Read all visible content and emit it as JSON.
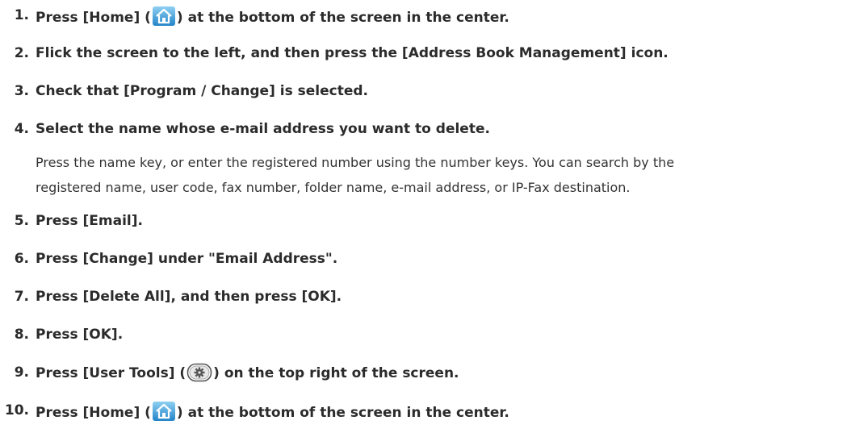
{
  "steps": [
    {
      "number": "1.",
      "before": "Press [Home] (",
      "icon": "home-icon",
      "after": ") at the bottom of the screen in the center."
    },
    {
      "number": "2.",
      "text": "Flick the screen to the left, and then press the [Address Book Management] icon."
    },
    {
      "number": "3.",
      "text": "Check that [Program / Change] is selected."
    },
    {
      "number": "4.",
      "text": "Select the name whose e-mail address you want to delete.",
      "note_lines": [
        "Press the name key, or enter the registered number using the number keys. You can search by the",
        "registered name, user code, fax number, folder name, e-mail address, or IP-Fax destination."
      ]
    },
    {
      "number": "5.",
      "text": "Press [Email]."
    },
    {
      "number": "6.",
      "text": "Press [Change] under \"Email Address\"."
    },
    {
      "number": "7.",
      "text": "Press [Delete All], and then press [OK]."
    },
    {
      "number": "8.",
      "text": "Press [OK]."
    },
    {
      "number": "9.",
      "before": "Press [User Tools] (",
      "icon": "user-tools-icon",
      "after": ") on the top right of the screen."
    },
    {
      "number": "10.",
      "before": "Press [Home] (",
      "icon": "home-icon",
      "after": ") at the bottom of the screen in the center."
    }
  ],
  "colors": {
    "text": "#2b2b2b",
    "home_icon_top": "#7fc6ee",
    "home_icon_bottom": "#2c8fd0"
  }
}
